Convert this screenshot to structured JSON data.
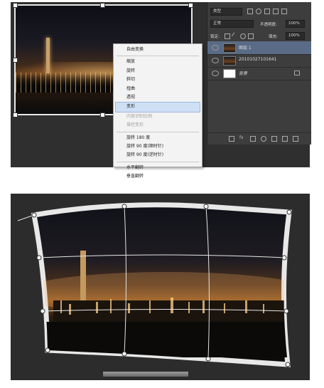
{
  "context_menu": {
    "items": [
      {
        "label": "自由变换",
        "state": "normal"
      },
      {
        "separator": true
      },
      {
        "label": "缩放",
        "state": "normal"
      },
      {
        "label": "旋转",
        "state": "normal"
      },
      {
        "label": "斜切",
        "state": "normal"
      },
      {
        "label": "扭曲",
        "state": "normal"
      },
      {
        "label": "透视",
        "state": "normal"
      },
      {
        "label": "变形",
        "state": "highlighted"
      },
      {
        "label": "内容识别比例",
        "state": "disabled"
      },
      {
        "label": "操控变形",
        "state": "disabled"
      },
      {
        "separator": true
      },
      {
        "label": "旋转 180 度",
        "state": "normal"
      },
      {
        "label": "旋转 90 度(顺时针)",
        "state": "normal"
      },
      {
        "label": "旋转 90 度(逆时针)",
        "state": "normal"
      },
      {
        "separator": true
      },
      {
        "label": "水平翻转",
        "state": "normal"
      },
      {
        "label": "垂直翻转",
        "state": "normal"
      }
    ]
  },
  "layers_panel": {
    "filter_kind": "类型",
    "blend_mode": "正常",
    "opacity_label": "不透明度:",
    "opacity_value": "100%",
    "lock_label": "锁定:",
    "fill_label": "填充:",
    "fill_value": "100%",
    "layers": [
      {
        "name": "图层 1",
        "selected": true,
        "thumb": "photo"
      },
      {
        "name": "20101027101641",
        "selected": false,
        "thumb": "photo"
      },
      {
        "name": "背景",
        "selected": false,
        "thumb": "white",
        "locked": true
      }
    ]
  },
  "colors": {
    "menu_highlight": "#cfe0f5",
    "panel_bg": "#3d3d3d",
    "selected_layer": "#596b86"
  }
}
